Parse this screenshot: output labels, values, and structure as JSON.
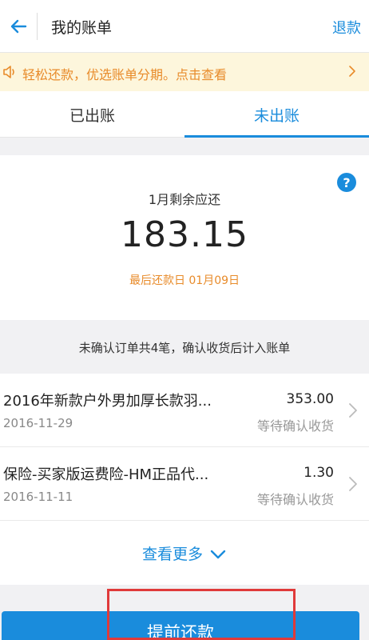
{
  "header": {
    "title": "我的账单",
    "refund_label": "退款"
  },
  "notice": {
    "text": "轻松还款，优选账单分期。点击查看"
  },
  "tabs": [
    {
      "label": "已出账"
    },
    {
      "label": "未出账"
    }
  ],
  "summary": {
    "period_label": "1月剩余应还",
    "amount": "183.15",
    "due_label": "最后还款日 01月09日",
    "help_glyph": "?"
  },
  "unconfirmed_text": "未确认订单共4笔，确认收货后计入账单",
  "orders": [
    {
      "name": "2016年新款户外男加厚长款羽...",
      "date": "2016-11-29",
      "amount": "353.00",
      "status": "等待确认收货"
    },
    {
      "name": "保险-买家版运费险-HM正品代...",
      "date": "2016-11-11",
      "amount": "1.30",
      "status": "等待确认收货"
    }
  ],
  "more_label": "查看更多",
  "repay_label": "提前还款",
  "colors": {
    "accent": "#1a8cdc",
    "notice_text": "#e88b2a",
    "notice_bg": "#fdf6dc",
    "highlight": "#e03a3a"
  },
  "icons": {
    "back": "arrow-left-icon",
    "notice": "speaker-icon",
    "chevron": "chevron-right-icon",
    "more": "chevron-down-icon",
    "help": "question-icon"
  }
}
